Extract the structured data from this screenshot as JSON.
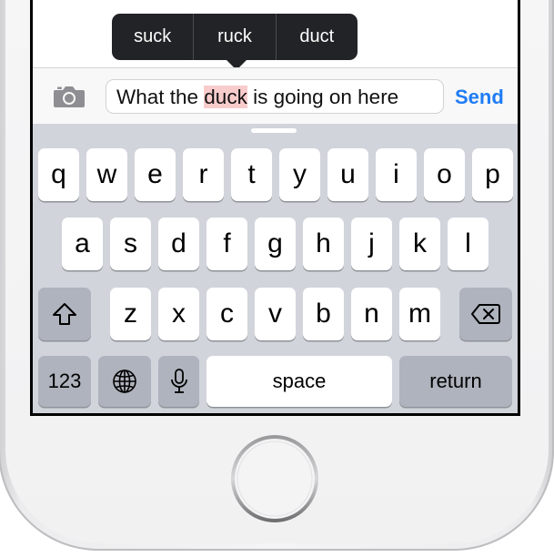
{
  "suggestions": [
    "suck",
    "ruck",
    "duct"
  ],
  "message": {
    "before": "What the ",
    "highlight": "duck",
    "after": " is going on here"
  },
  "send_label": "Send",
  "keys": {
    "row1": [
      "q",
      "w",
      "e",
      "r",
      "t",
      "y",
      "u",
      "i",
      "o",
      "p"
    ],
    "row2": [
      "a",
      "s",
      "d",
      "f",
      "g",
      "h",
      "j",
      "k",
      "l"
    ],
    "row3": [
      "z",
      "x",
      "c",
      "v",
      "b",
      "n",
      "m"
    ],
    "numbers_label": "123",
    "space_label": "space",
    "return_label": "return"
  },
  "icons": {
    "camera": "camera-icon",
    "shift": "shift-icon",
    "backspace": "backspace-icon",
    "globe": "globe-icon",
    "mic": "microphone-icon",
    "home": "home-button"
  },
  "colors": {
    "send": "#1f7cf4",
    "highlight": "#f9cccc",
    "keyboard_bg": "#d1d4db",
    "key_dark": "#aeb3bd"
  }
}
